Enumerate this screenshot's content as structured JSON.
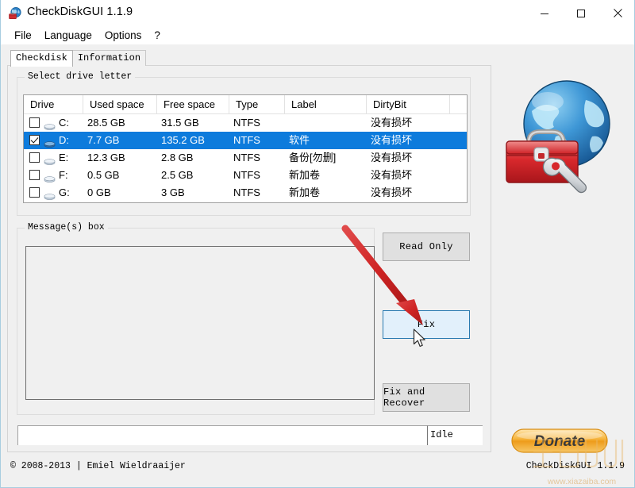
{
  "window": {
    "title": "CheckDiskGUI 1.1.9",
    "icon": "globe-toolbox-icon",
    "controls": {
      "minimize": "minimize-icon",
      "maximize": "maximize-icon",
      "close": "close-icon"
    }
  },
  "menubar": {
    "items": [
      {
        "label": "File"
      },
      {
        "label": "Language"
      },
      {
        "label": "Options"
      },
      {
        "label": "?"
      }
    ]
  },
  "tabs": [
    {
      "label": "Checkdisk",
      "active": true
    },
    {
      "label": "Information",
      "active": false
    }
  ],
  "drive_group": {
    "title": "Select drive letter",
    "columns": [
      "Drive",
      "Used space",
      "Free space",
      "Type",
      "Label",
      "DirtyBit",
      ""
    ],
    "rows": [
      {
        "checked": false,
        "selected": false,
        "drive": "C:",
        "used": "28.5 GB",
        "free": "31.5 GB",
        "type": "NTFS",
        "label": "",
        "dirtybit": "没有损坏"
      },
      {
        "checked": true,
        "selected": true,
        "drive": "D:",
        "used": "7.7 GB",
        "free": "135.2 GB",
        "type": "NTFS",
        "label": "软件",
        "dirtybit": "没有损坏"
      },
      {
        "checked": false,
        "selected": false,
        "drive": "E:",
        "used": "12.3 GB",
        "free": "2.8 GB",
        "type": "NTFS",
        "label": "备份[勿删]",
        "dirtybit": "没有损坏"
      },
      {
        "checked": false,
        "selected": false,
        "drive": "F:",
        "used": "0.5 GB",
        "free": "2.5 GB",
        "type": "NTFS",
        "label": "新加卷",
        "dirtybit": "没有损坏"
      },
      {
        "checked": false,
        "selected": false,
        "drive": "G:",
        "used": "0 GB",
        "free": "3 GB",
        "type": "NTFS",
        "label": "新加卷",
        "dirtybit": "没有损坏"
      }
    ]
  },
  "message_group": {
    "title": "Message(s) box",
    "content": ""
  },
  "actions": {
    "read_only": "Read Only",
    "fix": "Fix",
    "fix_and_recover": "Fix and Recover"
  },
  "status": {
    "progress_value": "",
    "state": "Idle"
  },
  "footer": {
    "copyright": "© 2008-2013 | Emiel Wieldraaijer",
    "version": "CheckDiskGUI 1.1.9"
  },
  "donate": {
    "label": "Donate"
  },
  "watermark": {
    "url": "www.xiazaiba.com"
  },
  "colors": {
    "selection_blue": "#0d7bdc",
    "fix_button_fill": "#e2f0fb",
    "fix_button_border": "#2a7ab0",
    "annotation_red": "#d42b2b",
    "donate_orange": "#f0a030",
    "window_border": "#a8cde0"
  }
}
